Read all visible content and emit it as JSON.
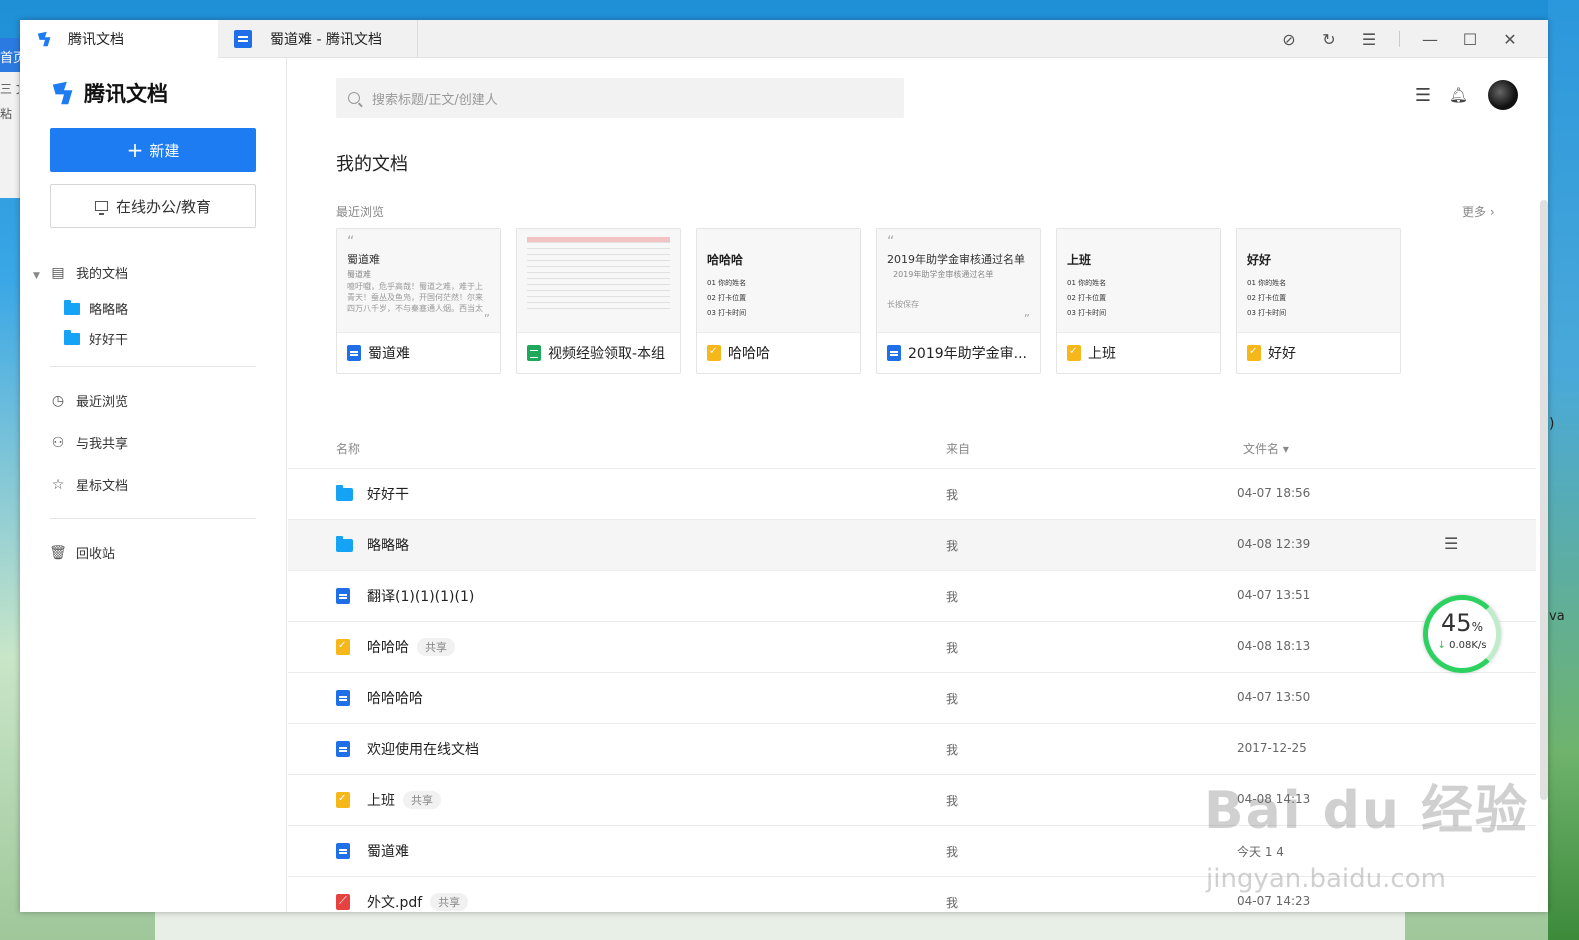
{
  "desktop": {
    "left_tab": "首页",
    "left_line1": "三 文",
    "left_line2": "粘",
    "right_text1": ")",
    "right_text2": "va"
  },
  "tabs": [
    {
      "label": "腾讯文档"
    },
    {
      "label": "蜀道难 - 腾讯文档"
    }
  ],
  "sidebar": {
    "brand": "腾讯文档",
    "new_button": "新建",
    "office_button": "在线办公/教育",
    "my_docs": "我的文档",
    "folders": [
      "略略略",
      "好好干"
    ],
    "recent": "最近浏览",
    "shared": "与我共享",
    "starred": "星标文档",
    "trash": "回收站"
  },
  "main": {
    "search_placeholder": "搜索标题/正文/创建人",
    "page_title": "我的文档",
    "recent_label": "最近浏览",
    "more": "更多 ›",
    "cards": [
      {
        "title": "蜀道难",
        "type": "doc",
        "preview_title": "蜀道难",
        "preview_sub": "蜀道难",
        "preview_body": "噫吁嚱，危乎高哉！蜀道之难，难于上青天！蚕丛及鱼凫，开国何茫然！尔来四万八千岁，不与秦塞通人烟。西当太"
      },
      {
        "title": "视频经验领取-本组",
        "type": "sheet"
      },
      {
        "title": "哈哈哈",
        "type": "form",
        "preview_title": "哈哈哈",
        "lines": [
          "01  你的姓名",
          "02  打卡位置",
          "03  打卡时间"
        ]
      },
      {
        "title": "2019年助学金审...",
        "type": "doc",
        "preview_title": "2019年助学金审核通过名单",
        "preview_sub": "2019年助学金审核通过名单",
        "preview_body": "长按保存"
      },
      {
        "title": "上班",
        "type": "form",
        "preview_title": "上班",
        "lines": [
          "01  你的姓名",
          "02  打卡位置",
          "03  打卡时间"
        ]
      },
      {
        "title": "好好",
        "type": "form",
        "preview_title": "好好",
        "lines": [
          "01  你的姓名",
          "02  打卡位置",
          "03  打卡时间"
        ]
      }
    ],
    "columns": {
      "name": "名称",
      "from": "来自",
      "sort": "文件名 ▾"
    },
    "rows": [
      {
        "name": "好好干",
        "type": "folder",
        "tag": "",
        "from": "我",
        "time": "04-07 18:56"
      },
      {
        "name": "略略略",
        "type": "folder",
        "tag": "",
        "from": "我",
        "time": "04-08 12:39"
      },
      {
        "name": "翻译(1)(1)(1)(1)",
        "type": "doc",
        "tag": "",
        "from": "我",
        "time": "04-07 13:51"
      },
      {
        "name": "哈哈哈",
        "type": "form",
        "tag": "共享",
        "from": "我",
        "time": "04-08 18:13"
      },
      {
        "name": "哈哈哈哈",
        "type": "doc",
        "tag": "",
        "from": "我",
        "time": "04-07 13:50"
      },
      {
        "name": "欢迎使用在线文档",
        "type": "doc",
        "tag": "",
        "from": "我",
        "time": "2017-12-25"
      },
      {
        "name": "上班",
        "type": "form",
        "tag": "共享",
        "from": "我",
        "time": "04-08 14:13"
      },
      {
        "name": "蜀道难",
        "type": "doc",
        "tag": "",
        "from": "我",
        "time": "今天 1 4"
      },
      {
        "name": "外文.pdf",
        "type": "pdf",
        "tag": "共享",
        "from": "我",
        "time": "04-07 14:23"
      }
    ]
  },
  "speed_widget": {
    "percent": "45",
    "unit": "%",
    "rate": "0.08K/s"
  },
  "watermark": {
    "main": "Bai du 经验",
    "sub": "jingyan.baidu.com"
  }
}
